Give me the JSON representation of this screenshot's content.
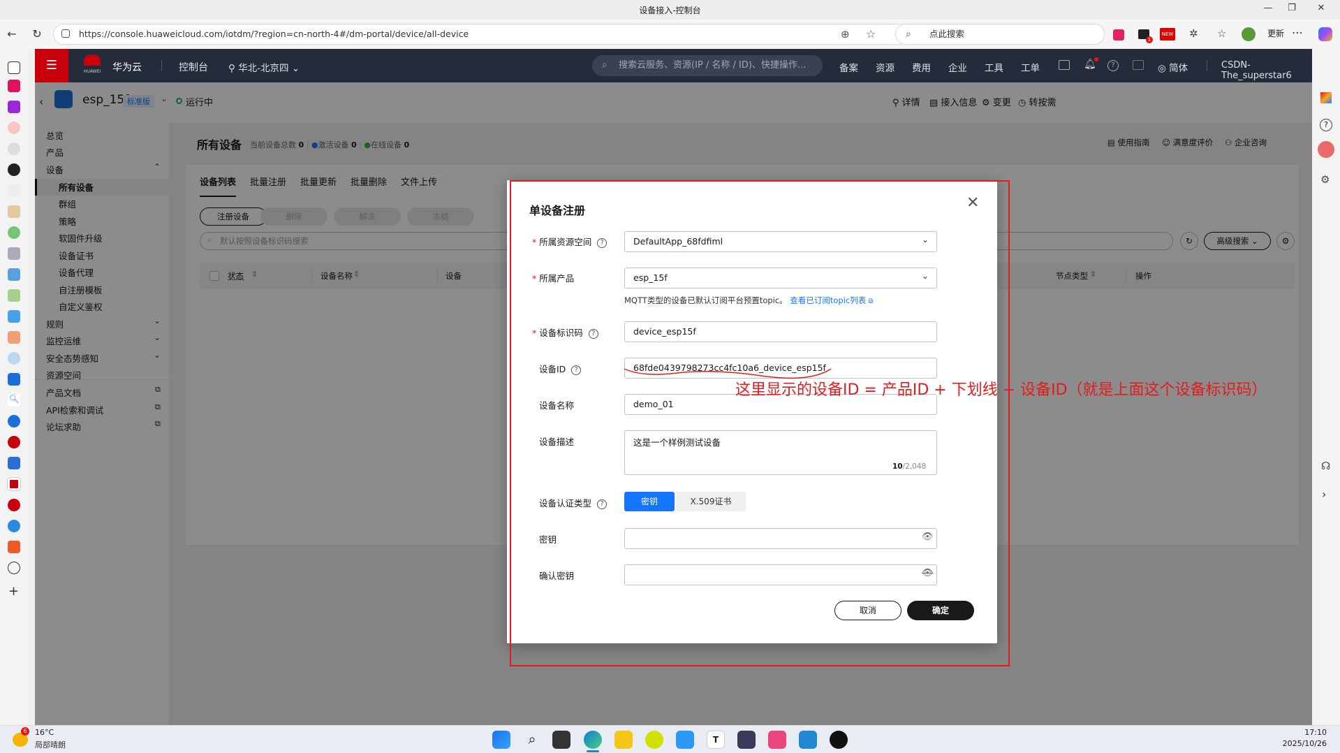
{
  "window": {
    "title": "设备接入-控制台"
  },
  "browser": {
    "url": "https://console.huaweicloud.com/iotdm/?region=cn-north-4#/dm-portal/device/all-device",
    "search_placeholder": "点此搜索",
    "update_label": "更新",
    "new_badge": "NEW",
    "notif_count": "1"
  },
  "topbar": {
    "brand": "华为云",
    "brand_sub": "HUAWEI",
    "console": "控制台",
    "region": "华北-北京四",
    "search_placeholder": "搜索云服务、资源(IP / 名称 / ID)、快捷操作...",
    "menu": [
      "备案",
      "资源",
      "费用",
      "企业",
      "工具",
      "工单"
    ],
    "lang": "简体",
    "user": "CSDN-The_superstar6"
  },
  "instance": {
    "name": "esp_15f",
    "edition": "标准版",
    "status": "运行中",
    "actions": [
      "详情",
      "接入信息",
      "变更",
      "转按需"
    ]
  },
  "leftnav": {
    "items": [
      "总览",
      "产品",
      "设备"
    ],
    "device_sub": [
      "所有设备",
      "群组",
      "策略",
      "软固件升级",
      "设备证书",
      "设备代理",
      "自注册模板",
      "自定义鉴权"
    ],
    "more": [
      "规则",
      "监控运维",
      "安全态势感知",
      "资源空间"
    ],
    "links": [
      "产品文档",
      "API检索和调试",
      "论坛求助"
    ]
  },
  "page": {
    "title": "所有设备",
    "stats": {
      "total_label": "当前设备总数",
      "total": "0",
      "active_label": "激活设备",
      "active": "0",
      "online_label": "在线设备",
      "online": "0"
    },
    "header_links": [
      "使用指南",
      "满意度评价",
      "企业咨询"
    ],
    "tabs": [
      "设备列表",
      "批量注册",
      "批量更新",
      "批量删除",
      "文件上传"
    ],
    "buttons": [
      "注册设备",
      "删除",
      "解冻",
      "冻结"
    ],
    "search_placeholder": "默认按照设备标识码搜索",
    "advanced_search": "高级搜索",
    "columns": {
      "status": "状态",
      "name": "设备名称",
      "id_partial": "设备",
      "node_type": "节点类型",
      "ops": "操作"
    }
  },
  "dialog": {
    "title": "单设备注册",
    "fields": {
      "space": {
        "label": "所属资源空间",
        "value": "DefaultApp_68fdfiml"
      },
      "product": {
        "label": "所属产品",
        "value": "esp_15f",
        "hint": "MQTT类型的设备已默认订阅平台预置topic。",
        "hint_link": "查看已订阅topic列表"
      },
      "node_id": {
        "label": "设备标识码",
        "value": "device_esp15f"
      },
      "device_id": {
        "label": "设备ID",
        "value": "68fde0439798273cc4fc10a6_device_esp15f"
      },
      "device_name": {
        "label": "设备名称",
        "value": "demo_01"
      },
      "desc": {
        "label": "设备描述",
        "value": "这是一个样例测试设备",
        "count": "10",
        "max": "/2,048"
      },
      "auth": {
        "label": "设备认证类型",
        "opt1": "密钥",
        "opt2": "X.509证书"
      },
      "secret": {
        "label": "密钥",
        "value": ""
      },
      "confirm": {
        "label": "确认密钥",
        "value": ""
      }
    },
    "cancel": "取消",
    "ok": "确定"
  },
  "annotation": "这里显示的设备ID = 产品ID + 下划线 + 设备ID（就是上面这个设备标识码）",
  "taskbar": {
    "weather_temp": "16°C",
    "weather_desc": "局部晴朗",
    "weather_badge": "6",
    "time": "17:10",
    "date": "2025/10/26"
  },
  "colors": {
    "accent": "#1476ff",
    "brand_red": "#c7000b",
    "annotation": "#e21c1c"
  }
}
